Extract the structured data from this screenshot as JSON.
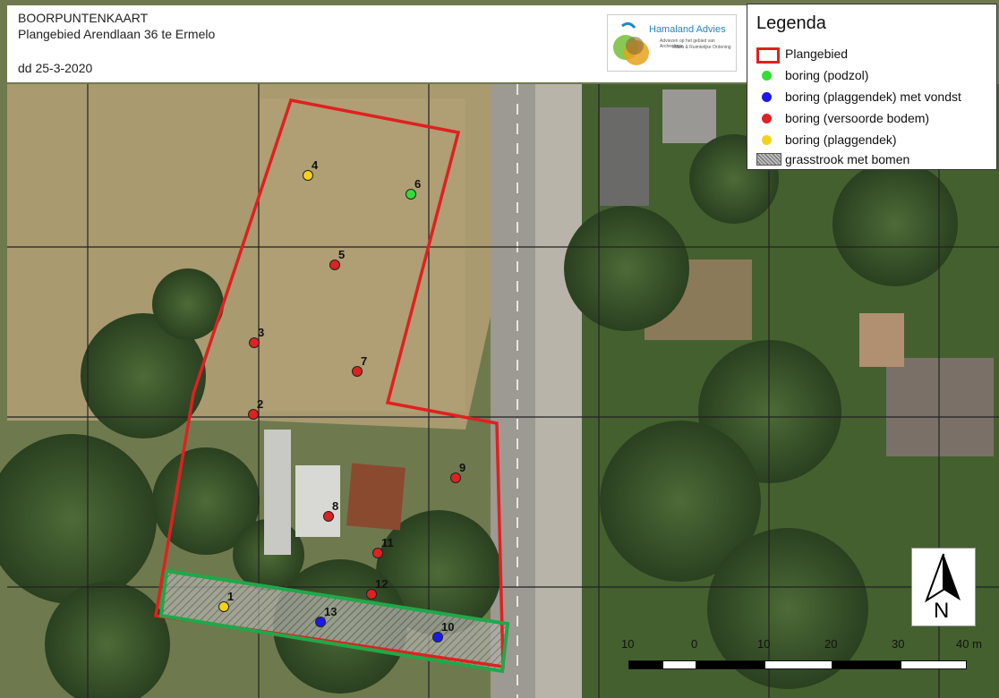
{
  "header": {
    "title": "BOORPUNTENKAART",
    "subtitle": "Plangebied Arendlaan 36 te Ermelo",
    "date": "dd 25-3-2020"
  },
  "logo": {
    "name": "Hamaland Advies",
    "tagline_1": "Adviezen op het gebied van Archeologie",
    "tagline_2": "Milieu & Ruimtelijke Ordening"
  },
  "legend": {
    "title": "Legenda",
    "items": [
      {
        "label": "Plangebied",
        "icon": "red-outline-rect",
        "color": "#e02020"
      },
      {
        "label": "boring (podzol)",
        "icon": "green-dot",
        "color": "#33dd33"
      },
      {
        "label": "boring (plaggendek) met vondst",
        "icon": "blue-dot",
        "color": "#1a1ae6"
      },
      {
        "label": "boring (versoorde bodem)",
        "icon": "red-dot",
        "color": "#dd2222"
      },
      {
        "label": "boring (plaggendek)",
        "icon": "yellow-dot",
        "color": "#f2d21c"
      },
      {
        "label": "grasstrook met bomen",
        "icon": "hatched-rect",
        "color": "#888888"
      }
    ]
  },
  "boreholes": [
    {
      "label": "1",
      "type": "plaggendek",
      "color": "#f2d21c"
    },
    {
      "label": "2",
      "type": "versoorde bodem",
      "color": "#dd2222"
    },
    {
      "label": "3",
      "type": "versoorde bodem",
      "color": "#dd2222"
    },
    {
      "label": "4",
      "type": "plaggendek",
      "color": "#f2d21c"
    },
    {
      "label": "5",
      "type": "versoorde bodem",
      "color": "#dd2222"
    },
    {
      "label": "6",
      "type": "podzol",
      "color": "#33dd33"
    },
    {
      "label": "7",
      "type": "versoorde bodem",
      "color": "#dd2222"
    },
    {
      "label": "8",
      "type": "versoorde bodem",
      "color": "#dd2222"
    },
    {
      "label": "9",
      "type": "versoorde bodem",
      "color": "#dd2222"
    },
    {
      "label": "10",
      "type": "plaggendek met vondst",
      "color": "#1a1ae6"
    },
    {
      "label": "11",
      "type": "versoorde bodem",
      "color": "#dd2222"
    },
    {
      "label": "12",
      "type": "versoorde bodem",
      "color": "#dd2222"
    },
    {
      "label": "13",
      "type": "plaggendek met vondst",
      "color": "#1a1ae6"
    }
  ],
  "north_arrow": {
    "label": "N",
    "icon": "north-arrow-icon"
  },
  "scale_bar": {
    "labels": [
      "10",
      "0",
      "10",
      "20",
      "30",
      "40 m"
    ]
  }
}
